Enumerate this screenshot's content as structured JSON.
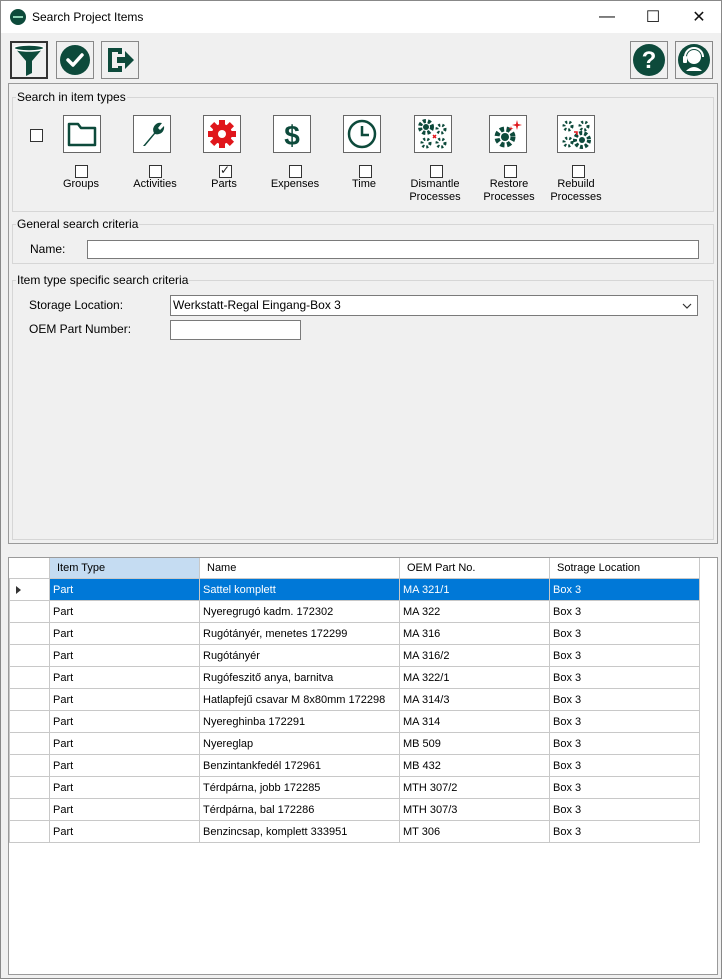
{
  "window": {
    "title": "Search Project Items",
    "minimize": "—",
    "maximize": "☐",
    "close": "✕"
  },
  "colors": {
    "icon_dark": "#0d4a3b",
    "icon_red": "#e0161b",
    "selection": "#0078d7",
    "column_selected": "#c5dcf2"
  },
  "toolbar": {
    "left": [
      {
        "icon": "filter-icon",
        "active": true
      },
      {
        "icon": "check-icon",
        "active": false
      },
      {
        "icon": "exit-icon",
        "active": false
      }
    ],
    "right": [
      {
        "icon": "help-icon"
      },
      {
        "icon": "support-headset-icon"
      }
    ]
  },
  "item_types": {
    "legend": "Search in item types",
    "select_all_checked": false,
    "types": [
      {
        "label": "Groups",
        "icon": "folder-icon",
        "checked": false
      },
      {
        "label": "Activities",
        "icon": "wrench-icon",
        "checked": false
      },
      {
        "label": "Parts",
        "icon": "gear-icon",
        "checked": true
      },
      {
        "label": "Expenses",
        "icon": "dollar-icon",
        "checked": false
      },
      {
        "label": "Time",
        "icon": "clock-icon",
        "checked": false
      },
      {
        "label": "Dismantle\nProcesses",
        "icon": "dismantle-gears-icon",
        "checked": false
      },
      {
        "label": "Restore\nProcesses",
        "icon": "restore-gear-icon",
        "checked": false
      },
      {
        "label": "Rebuild\nProcesses",
        "icon": "rebuild-gears-icon",
        "checked": false
      }
    ]
  },
  "general": {
    "legend": "General search criteria",
    "name_label": "Name:",
    "name_value": ""
  },
  "specific": {
    "legend": "Item type specific search criteria",
    "storage_label": "Storage Location:",
    "storage_value": "Werkstatt-Regal Eingang-Box 3",
    "oem_label": "OEM Part Number:",
    "oem_value": ""
  },
  "grid": {
    "columns": [
      "Item Type",
      "Name",
      "OEM Part No.",
      "Sotrage Location"
    ],
    "selected_row": 0,
    "rows": [
      [
        "Part",
        "Sattel komplett",
        "MA 321/1",
        "Box 3"
      ],
      [
        "Part",
        "Nyeregrugó kadm. 172302",
        "MA 322",
        "Box 3"
      ],
      [
        "Part",
        "Rugótányér, menetes 172299",
        "MA 316",
        "Box 3"
      ],
      [
        "Part",
        "Rugótányér",
        "MA 316/2",
        "Box 3"
      ],
      [
        "Part",
        "Rugófeszitő anya, barnitva",
        "MA 322/1",
        "Box 3"
      ],
      [
        "Part",
        "Hatlapfejű csavar M 8x80mm 172298",
        "MA 314/3",
        "Box 3"
      ],
      [
        "Part",
        "Nyereghinba 172291",
        "MA 314",
        "Box 3"
      ],
      [
        "Part",
        "Nyereglap",
        "MB 509",
        "Box 3"
      ],
      [
        "Part",
        "Benzintankfedél 172961",
        "MB 432",
        "Box 3"
      ],
      [
        "Part",
        "Térdpárna, jobb 172285",
        "MTH 307/2",
        "Box 3"
      ],
      [
        "Part",
        "Térdpárna, bal 172286",
        "MTH 307/3",
        "Box 3"
      ],
      [
        "Part",
        "Benzincsap, komplett 333951",
        "MT 306",
        "Box 3"
      ]
    ]
  }
}
